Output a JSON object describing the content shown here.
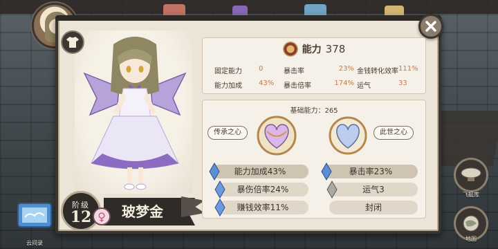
{
  "panel": {
    "ability": {
      "label": "能力",
      "value": "378"
    },
    "stats": [
      {
        "label": "固定能力",
        "value": "0"
      },
      {
        "label": "暴击率",
        "value": "23%"
      },
      {
        "label": "金钱转化效率",
        "value": "111%"
      },
      {
        "label": "能力加成",
        "value": "43%"
      },
      {
        "label": "暴击倍率",
        "value": "174%"
      },
      {
        "label": "运气",
        "value": "33"
      }
    ],
    "base_ability": "基础能力：265",
    "hearts": {
      "left": "传承之心",
      "right": "此世之心"
    },
    "attributes": [
      {
        "text": "能力加成43%",
        "gem": "blue"
      },
      {
        "text": "暴击率23%",
        "gem": "blue"
      },
      {
        "text": "暴伤倍率24%",
        "gem": "blue"
      },
      {
        "text": "运气3",
        "gem": "gray"
      },
      {
        "text": "赚钱效率11%",
        "gem": "blue"
      },
      {
        "text": "封闭",
        "gem": "none"
      }
    ]
  },
  "character": {
    "name": "玻梦金",
    "stage_label": "阶级",
    "stage": "12",
    "gender_symbol": "♀"
  },
  "side": {
    "airship_label": "飞艇库",
    "map_label": "地图",
    "cloud_label": "云间录"
  },
  "colors": {
    "accent_orange": "#c8774a",
    "panel_bg": "#ece4d6",
    "dark_frame": "#3a3531",
    "gem_blue": "#5a8fd6"
  },
  "icons": [
    "shirt-icon",
    "close-icon",
    "ability-icon",
    "airship-icon",
    "map-icon",
    "cloud-book-icon"
  ]
}
